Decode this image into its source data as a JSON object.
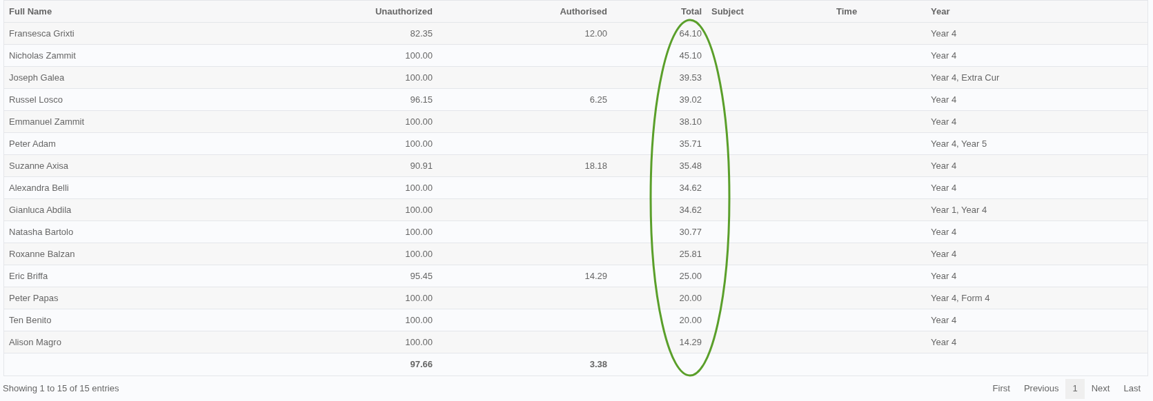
{
  "table": {
    "columns": [
      "Full Name",
      "Unauthorized",
      "Authorised",
      "Total",
      "Subject",
      "Time",
      "Year"
    ],
    "rows": [
      [
        "Fransesca Grixti",
        "82.35",
        "12.00",
        "64.10",
        "",
        "",
        "Year 4"
      ],
      [
        "Nicholas Zammit",
        "100.00",
        "",
        "45.10",
        "",
        "",
        "Year 4"
      ],
      [
        "Joseph Galea",
        "100.00",
        "",
        "39.53",
        "",
        "",
        "Year 4, Extra Cur"
      ],
      [
        "Russel Losco",
        "96.15",
        "6.25",
        "39.02",
        "",
        "",
        "Year 4"
      ],
      [
        "Emmanuel Zammit",
        "100.00",
        "",
        "38.10",
        "",
        "",
        "Year 4"
      ],
      [
        "Peter Adam",
        "100.00",
        "",
        "35.71",
        "",
        "",
        "Year 4, Year 5"
      ],
      [
        "Suzanne Axisa",
        "90.91",
        "18.18",
        "35.48",
        "",
        "",
        "Year 4"
      ],
      [
        "Alexandra Belli",
        "100.00",
        "",
        "34.62",
        "",
        "",
        "Year 4"
      ],
      [
        "Gianluca Abdila",
        "100.00",
        "",
        "34.62",
        "",
        "",
        "Year 1, Year 4"
      ],
      [
        "Natasha Bartolo",
        "100.00",
        "",
        "30.77",
        "",
        "",
        "Year 4"
      ],
      [
        "Roxanne Balzan",
        "100.00",
        "",
        "25.81",
        "",
        "",
        "Year 4"
      ],
      [
        "Eric Briffa",
        "95.45",
        "14.29",
        "25.00",
        "",
        "",
        "Year 4"
      ],
      [
        "Peter Papas",
        "100.00",
        "",
        "20.00",
        "",
        "",
        "Year 4, Form 4"
      ],
      [
        "Ten Benito",
        "100.00",
        "",
        "20.00",
        "",
        "",
        "Year 4"
      ],
      [
        "Alison Magro",
        "100.00",
        "",
        "14.29",
        "",
        "",
        "Year 4"
      ]
    ],
    "footer": {
      "unauthorized": "97.66",
      "authorised": "3.38"
    }
  },
  "highlight": {
    "kind": "ellipse"
  },
  "info": "Showing 1 to 15 of 15 entries",
  "pagination": [
    {
      "label": "First",
      "selected": false
    },
    {
      "label": "Previous",
      "selected": false
    },
    {
      "label": "1",
      "selected": true
    },
    {
      "label": "Next",
      "selected": false
    },
    {
      "label": "Last",
      "selected": false
    }
  ]
}
